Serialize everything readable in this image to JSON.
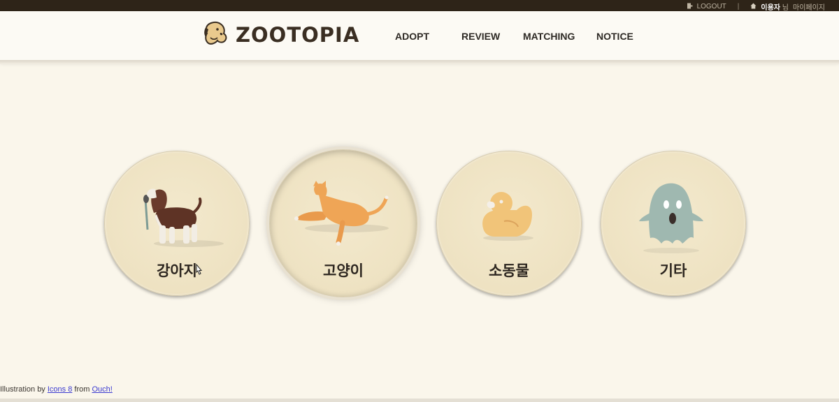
{
  "topbar": {
    "logout": "LOGOUT",
    "separator": "|",
    "user_name": "이용자",
    "user_suffix": "님",
    "mypage": "마이페이지",
    "logout_icon": "door-icon",
    "home_icon": "home-icon"
  },
  "header": {
    "logo_text": "ZOOTOPIA",
    "logo_icon": "dog-head-icon",
    "nav": [
      {
        "label": "ADOPT"
      },
      {
        "label": "REVIEW"
      },
      {
        "label": "MATCHING"
      },
      {
        "label": "NOTICE"
      }
    ]
  },
  "categories": [
    {
      "label": "강아지",
      "icon": "dog-illustration"
    },
    {
      "label": "고양이",
      "icon": "cat-illustration"
    },
    {
      "label": "소동물",
      "icon": "duck-illustration"
    },
    {
      "label": "기타",
      "icon": "ghost-illustration"
    }
  ],
  "footer": {
    "prefix": "Illustration  by",
    "link1": "Icons 8",
    "middle": "from",
    "link2": "Ouch!"
  },
  "colors": {
    "topbar_bg": "#2e2418",
    "page_bg": "#faf6eb",
    "card_bg": "#eee2c2",
    "text_dark": "#2d2620"
  }
}
